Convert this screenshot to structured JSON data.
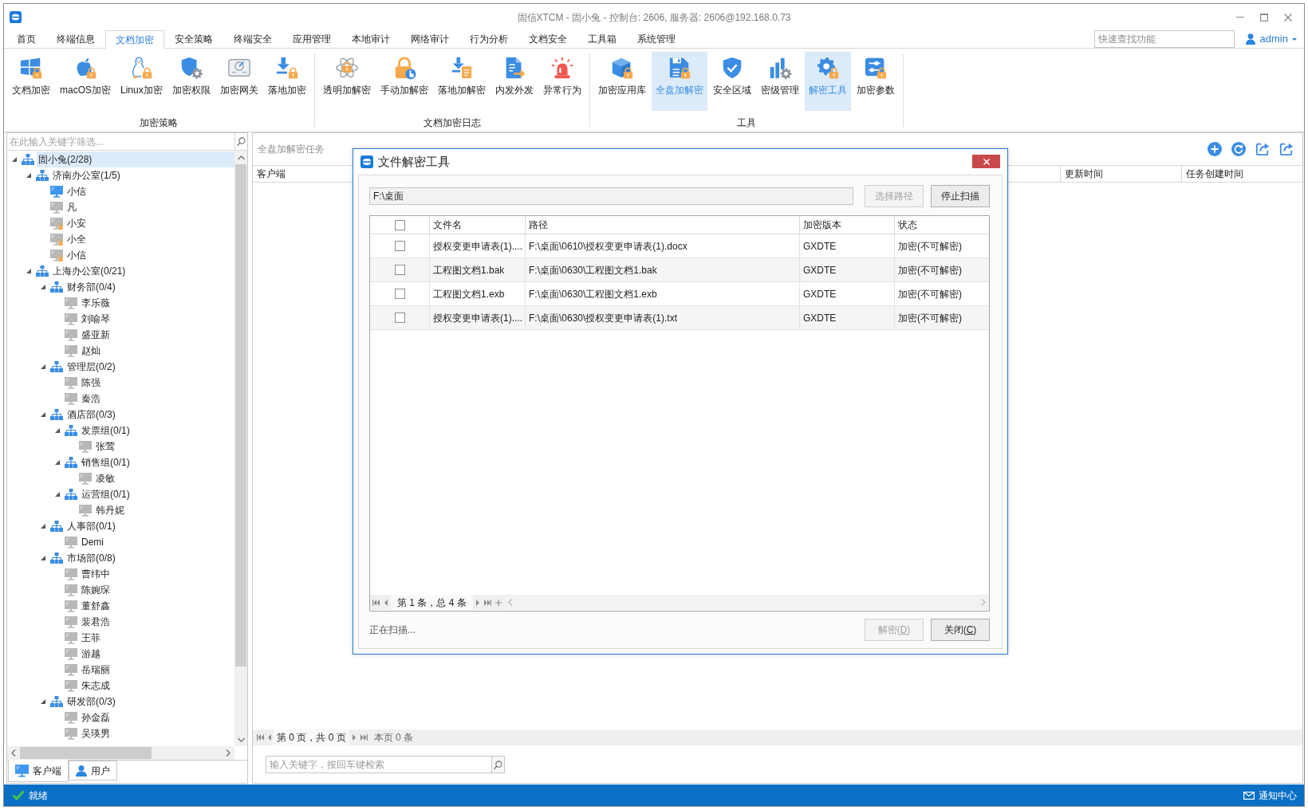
{
  "window": {
    "title": "固信XTCM - 固小兔 - 控制台: 2606, 服务器: 2606@192.168.0.73"
  },
  "menu_tabs": [
    {
      "label": "首页",
      "selected": false
    },
    {
      "label": "终端信息",
      "selected": false
    },
    {
      "label": "文档加密",
      "selected": true
    },
    {
      "label": "安全策略",
      "selected": false
    },
    {
      "label": "终端安全",
      "selected": false
    },
    {
      "label": "应用管理",
      "selected": false
    },
    {
      "label": "本地审计",
      "selected": false
    },
    {
      "label": "网络审计",
      "selected": false
    },
    {
      "label": "行为分析",
      "selected": false
    },
    {
      "label": "文档安全",
      "selected": false
    },
    {
      "label": "工具箱",
      "selected": false
    },
    {
      "label": "系统管理",
      "selected": false
    }
  ],
  "quick_search": {
    "placeholder": "快速查找功能"
  },
  "user": {
    "name": "admin"
  },
  "ribbon": {
    "groups": [
      {
        "label": "加密策略",
        "buttons": [
          {
            "label": "文档加密",
            "selected": false
          },
          {
            "label": "macOS加密",
            "selected": false
          },
          {
            "label": "Linux加密",
            "selected": false
          },
          {
            "label": "加密权限",
            "selected": false
          },
          {
            "label": "加密网关",
            "selected": false
          },
          {
            "label": "落地加密",
            "selected": false
          }
        ]
      },
      {
        "label": "文档加密日志",
        "buttons": [
          {
            "label": "透明加解密",
            "selected": false
          },
          {
            "label": "手动加解密",
            "selected": false
          },
          {
            "label": "落地加解密",
            "selected": false
          },
          {
            "label": "内发外发",
            "selected": false
          },
          {
            "label": "异常行为",
            "selected": false
          }
        ]
      },
      {
        "label": "工具",
        "buttons": [
          {
            "label": "加密应用库",
            "selected": false
          },
          {
            "label": "全盘加解密",
            "selected": true
          },
          {
            "label": "安全区域",
            "selected": false
          },
          {
            "label": "密级管理",
            "selected": false
          },
          {
            "label": "解密工具",
            "selected": true
          },
          {
            "label": "加密参数",
            "selected": false
          }
        ]
      }
    ]
  },
  "sidebar": {
    "filter": {
      "placeholder": "在此输入关键字筛选..."
    },
    "tree": [
      {
        "label": "固小兔(2/28)",
        "kind": "group",
        "expanded": true,
        "selected": true,
        "children": [
          {
            "label": "济南办公室(1/5)",
            "kind": "group",
            "expanded": true,
            "selected": false,
            "children": [
              {
                "label": "小信",
                "kind": "computer",
                "online": true,
                "locked": false,
                "selected": false
              },
              {
                "label": "凡",
                "kind": "computer",
                "online": false,
                "locked": false,
                "selected": false
              },
              {
                "label": "小安",
                "kind": "computer",
                "online": false,
                "locked": true,
                "selected": false
              },
              {
                "label": "小全",
                "kind": "computer",
                "online": false,
                "locked": true,
                "selected": false
              },
              {
                "label": "小信",
                "kind": "computer",
                "online": false,
                "locked": true,
                "selected": false
              }
            ]
          },
          {
            "label": "上海办公室(0/21)",
            "kind": "group",
            "expanded": true,
            "selected": false,
            "children": [
              {
                "label": "财务部(0/4)",
                "kind": "group",
                "expanded": true,
                "selected": false,
                "children": [
                  {
                    "label": "李乐薇",
                    "kind": "computer",
                    "online": false,
                    "locked": false,
                    "selected": false
                  },
                  {
                    "label": "刘喻琴",
                    "kind": "computer",
                    "online": false,
                    "locked": false,
                    "selected": false
                  },
                  {
                    "label": "盛亚新",
                    "kind": "computer",
                    "online": false,
                    "locked": false,
                    "selected": false
                  },
                  {
                    "label": "赵灿",
                    "kind": "computer",
                    "online": false,
                    "locked": false,
                    "selected": false
                  }
                ]
              },
              {
                "label": "管理层(0/2)",
                "kind": "group",
                "expanded": true,
                "selected": false,
                "children": [
                  {
                    "label": "陈强",
                    "kind": "computer",
                    "online": false,
                    "locked": false,
                    "selected": false
                  },
                  {
                    "label": "秦浩",
                    "kind": "computer",
                    "online": false,
                    "locked": false,
                    "selected": false
                  }
                ]
              },
              {
                "label": "酒店部(0/3)",
                "kind": "group",
                "expanded": true,
                "selected": false,
                "children": [
                  {
                    "label": "发票组(0/1)",
                    "kind": "group",
                    "expanded": true,
                    "selected": false,
                    "children": [
                      {
                        "label": "张莺",
                        "kind": "computer",
                        "online": false,
                        "locked": false,
                        "selected": false
                      }
                    ]
                  },
                  {
                    "label": "销售组(0/1)",
                    "kind": "group",
                    "expanded": true,
                    "selected": false,
                    "children": [
                      {
                        "label": "凌敏",
                        "kind": "computer",
                        "online": false,
                        "locked": false,
                        "selected": false
                      }
                    ]
                  },
                  {
                    "label": "运营组(0/1)",
                    "kind": "group",
                    "expanded": true,
                    "selected": false,
                    "children": [
                      {
                        "label": "韩丹妮",
                        "kind": "computer",
                        "online": false,
                        "locked": false,
                        "selected": false
                      }
                    ]
                  }
                ]
              },
              {
                "label": "人事部(0/1)",
                "kind": "group",
                "expanded": true,
                "selected": false,
                "children": [
                  {
                    "label": "Demi",
                    "kind": "computer",
                    "online": false,
                    "locked": false,
                    "selected": false
                  }
                ]
              },
              {
                "label": "市场部(0/8)",
                "kind": "group",
                "expanded": true,
                "selected": false,
                "children": [
                  {
                    "label": "曹纬中",
                    "kind": "computer",
                    "online": false,
                    "locked": false,
                    "selected": false
                  },
                  {
                    "label": "陈婉琛",
                    "kind": "computer",
                    "online": false,
                    "locked": false,
                    "selected": false
                  },
                  {
                    "label": "董舒鑫",
                    "kind": "computer",
                    "online": false,
                    "locked": false,
                    "selected": false
                  },
                  {
                    "label": "裴君浩",
                    "kind": "computer",
                    "online": false,
                    "locked": false,
                    "selected": false
                  },
                  {
                    "label": "王菲",
                    "kind": "computer",
                    "online": false,
                    "locked": false,
                    "selected": false
                  },
                  {
                    "label": "游越",
                    "kind": "computer",
                    "online": false,
                    "locked": false,
                    "selected": false
                  },
                  {
                    "label": "岳瑞丽",
                    "kind": "computer",
                    "online": false,
                    "locked": false,
                    "selected": false
                  },
                  {
                    "label": "朱志成",
                    "kind": "computer",
                    "online": false,
                    "locked": false,
                    "selected": false
                  }
                ]
              },
              {
                "label": "研发部(0/3)",
                "kind": "group",
                "expanded": true,
                "selected": false,
                "children": [
                  {
                    "label": "孙金磊",
                    "kind": "computer",
                    "online": false,
                    "locked": false,
                    "selected": false
                  },
                  {
                    "label": "吴瑛男",
                    "kind": "computer",
                    "online": false,
                    "locked": false,
                    "selected": false
                  }
                ]
              }
            ]
          }
        ]
      }
    ],
    "tabs": [
      {
        "label": "客户端",
        "selected": true
      },
      {
        "label": "用户",
        "selected": false
      }
    ]
  },
  "main": {
    "title": "全盘加解密任务",
    "columns": [
      "客户端",
      "更新时间",
      "任务创建时间"
    ],
    "pager": {
      "page_info": "第 0 页，共 0 页",
      "row_count": "本页 0 条"
    },
    "search": {
      "placeholder": "输入关键字，按回车键检索"
    }
  },
  "dialog": {
    "title": "文件解密工具",
    "path": {
      "value": "F:\\桌面"
    },
    "buttons": [
      {
        "label": "选择路径",
        "disabled": true
      },
      {
        "label": "停止扫描",
        "disabled": false
      }
    ],
    "table": {
      "select_all": {
        "checked": false
      },
      "columns": [
        "文件名",
        "路径",
        "加密版本",
        "状态"
      ],
      "rows": [
        {
          "checked": false,
          "cells": [
            "授权变更申请表(1)....",
            "F:\\桌面\\0610\\授权变更申请表(1).docx",
            "GXDTE",
            "加密(不可解密)"
          ]
        },
        {
          "checked": false,
          "cells": [
            "工程图文档1.bak",
            "F:\\桌面\\0630\\工程图文档1.bak",
            "GXDTE",
            "加密(不可解密)"
          ]
        },
        {
          "checked": false,
          "cells": [
            "工程图文档1.exb",
            "F:\\桌面\\0630\\工程图文档1.exb",
            "GXDTE",
            "加密(不可解密)"
          ]
        },
        {
          "checked": false,
          "cells": [
            "授权变更申请表(1)....",
            "F:\\桌面\\0630\\授权变更申请表(1).txt",
            "GXDTE",
            "加密(不可解密)"
          ]
        }
      ]
    },
    "pager": {
      "record_info": "第 1 条，总 4 条"
    },
    "status": "正在扫描...",
    "footer_buttons": [
      {
        "label": "解密(D)",
        "disabled": true,
        "access_key_underlined": true
      },
      {
        "label": "关闭(C)",
        "disabled": false,
        "access_key_underlined": true
      }
    ]
  },
  "status_bar": {
    "status": "就绪",
    "notifications": "通知中心"
  }
}
